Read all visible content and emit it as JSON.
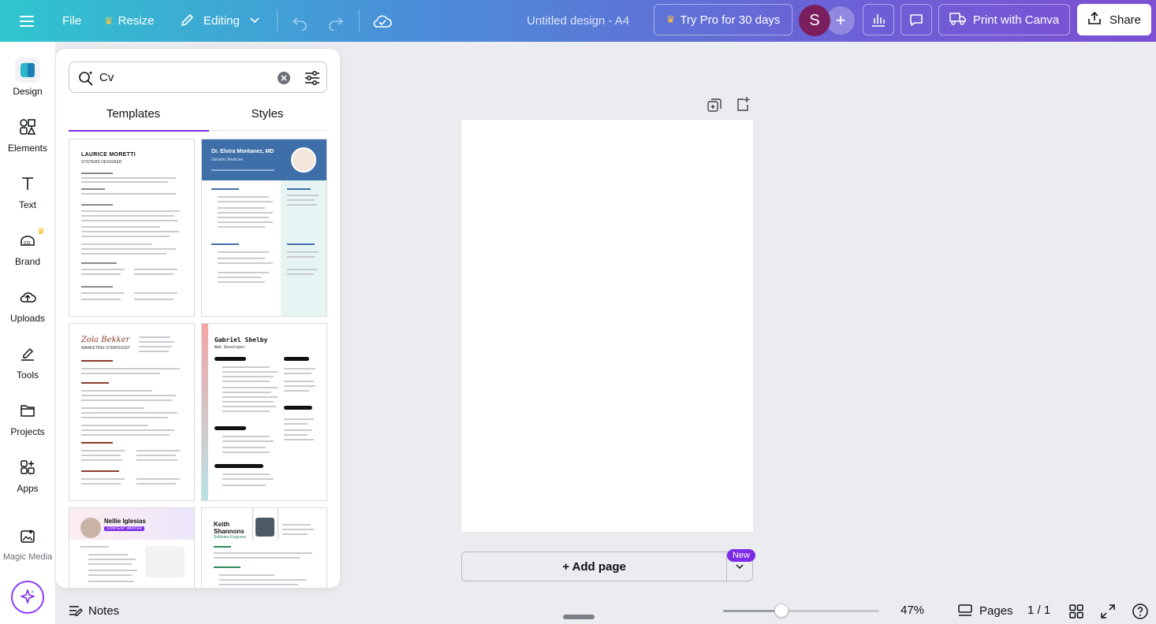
{
  "topbar": {
    "file": "File",
    "resize": "Resize",
    "editing": "Editing",
    "title": "Untitled design - A4",
    "try_pro": "Try Pro for 30 days",
    "avatar_initial": "S",
    "print": "Print with Canva",
    "share": "Share"
  },
  "rail": {
    "design": "Design",
    "elements": "Elements",
    "text": "Text",
    "brand": "Brand",
    "uploads": "Uploads",
    "tools": "Tools",
    "projects": "Projects",
    "apps": "Apps",
    "magic_media": "Magic Media"
  },
  "panel": {
    "search_value": "Cv",
    "tabs": {
      "templates": "Templates",
      "styles": "Styles"
    },
    "templates": [
      {
        "name": "LAURICE MORETTI",
        "subtitle": "SYSTEMS DESIGNER"
      },
      {
        "name": "Dr. Elvira Montanez, MD",
        "subtitle": "Geriatric Medicine"
      },
      {
        "name": "Zola Bekker",
        "subtitle": "MARKETING STRATEGIST"
      },
      {
        "name": "Gabriel Shelby",
        "subtitle": "Web Developer"
      },
      {
        "name": "Nellie Iglesias",
        "subtitle": "CONTENT WRITER"
      },
      {
        "name": "Keith Shannons",
        "subtitle": "Software Engineer"
      }
    ]
  },
  "canvas": {
    "add_page": "+ Add page",
    "new_badge": "New"
  },
  "bottombar": {
    "notes": "Notes",
    "zoom": "47%",
    "zoom_fraction": 0.47,
    "pages": "Pages",
    "page_count": "1 / 1"
  },
  "colors": {
    "brand_purple": "#7d2ae8",
    "avatar": "#7b1e5e"
  }
}
